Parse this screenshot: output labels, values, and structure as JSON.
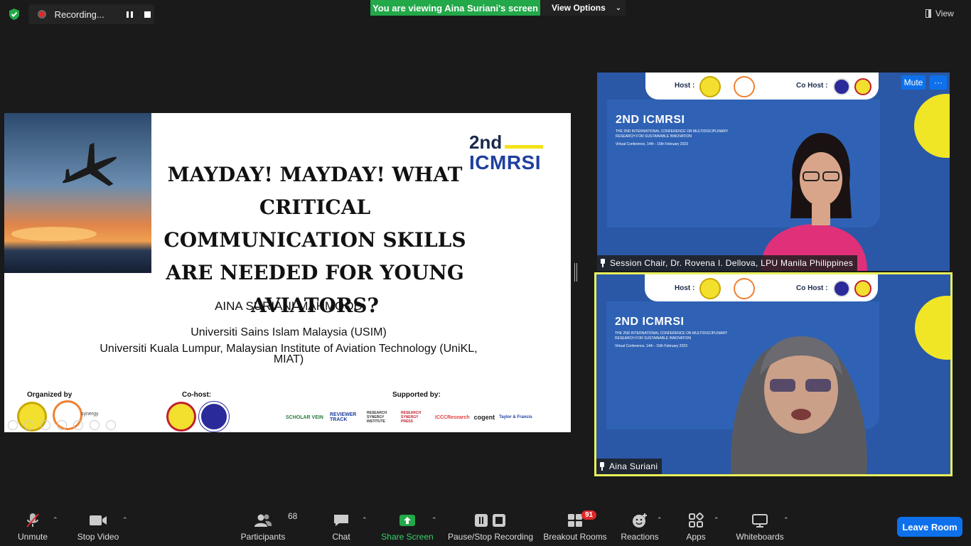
{
  "topbar": {
    "recording_label": "Recording...",
    "viewing_banner": "You are viewing Aina Suriani's screen",
    "view_options": "View Options",
    "view_label": "View"
  },
  "slide": {
    "title": "MAYDAY! MAYDAY! WHAT CRITICAL COMMUNICATION SKILLS ARE NEEDED FOR YOUNG AVIATORS?",
    "brand_ordinal": "2nd",
    "brand_name": "ICMRSI",
    "author": "AINA SURIANI MAHMOOD",
    "affiliation_1": "Universiti Sains Islam Malaysia (USIM)",
    "affiliation_2": "Universiti Kuala Lumpur, Malaysian Institute of Aviation Technology (UniKL, MIAT)",
    "organized_by": "Organized by",
    "co_host": "Co-host:",
    "supported_by": "Supported by:",
    "sponsors": [
      "SCHOLAR VEIN",
      "REVIEWER TRACK",
      "RESEARCH SYNERGY INSTITUTE",
      "RESEARCH SYNERGY PRESS",
      "ICCCResearch",
      "cogent",
      "Taylor & Francis"
    ]
  },
  "tile_banner": {
    "host": "Host :",
    "co_host": "Co Host :",
    "conf_title": "2ND ICMRSI",
    "conf_sub": "THE 2ND INTERNATIONAL CONFERENCE ON MULTIDISCIPLINARY RESEARCH FOR SUSTAINABLE INNOVATION",
    "conf_date": "Virtual Conference, 14th - 15th February 2023"
  },
  "participants_video": [
    {
      "name": "Session Chair, Dr. Rovena I. Dellova, LPU Manila Philippines",
      "mute_label": "Mute",
      "more_label": "···"
    },
    {
      "name": "Aina Suriani"
    }
  ],
  "toolbar": {
    "unmute": "Unmute",
    "stop_video": "Stop Video",
    "participants": "Participants",
    "participants_count": "68",
    "chat": "Chat",
    "share_screen": "Share Screen",
    "pause_stop_recording": "Pause/Stop Recording",
    "breakout_rooms": "Breakout Rooms",
    "breakout_count": "91",
    "reactions": "Reactions",
    "apps": "Apps",
    "whiteboards": "Whiteboards",
    "leave": "Leave Room"
  },
  "colors": {
    "zoom_blue": "#0e71eb",
    "banner_green": "#23a84a",
    "active_speaker": "#e8f05a"
  }
}
